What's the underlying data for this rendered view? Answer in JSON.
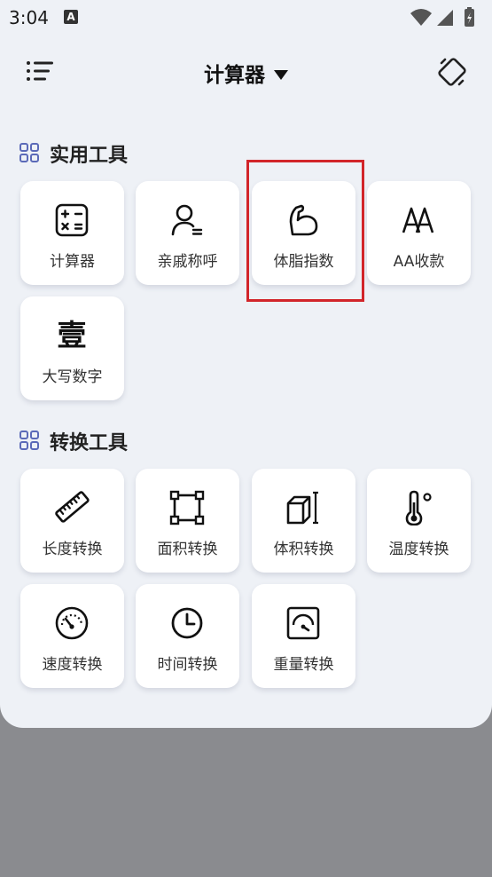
{
  "status": {
    "time": "3:04",
    "notification_icon": "A"
  },
  "header": {
    "title": "计算器"
  },
  "sections": [
    {
      "title": "实用工具",
      "tools": [
        {
          "label": "计算器",
          "icon": "calculator-icon"
        },
        {
          "label": "亲戚称呼",
          "icon": "person-icon"
        },
        {
          "label": "体脂指数",
          "icon": "muscle-arm-icon",
          "highlighted": true
        },
        {
          "label": "AA收款",
          "icon": "aa-text-icon",
          "glyph": "AA"
        },
        {
          "label": "大写数字",
          "icon": "chinese-numeral-icon",
          "glyph": "壹"
        }
      ]
    },
    {
      "title": "转换工具",
      "tools": [
        {
          "label": "长度转换",
          "icon": "ruler-icon"
        },
        {
          "label": "面积转换",
          "icon": "area-square-icon"
        },
        {
          "label": "体积转换",
          "icon": "cube-icon"
        },
        {
          "label": "温度转换",
          "icon": "thermometer-icon"
        },
        {
          "label": "速度转换",
          "icon": "speedometer-icon"
        },
        {
          "label": "时间转换",
          "icon": "clock-icon"
        },
        {
          "label": "重量转换",
          "icon": "scale-gauge-icon"
        }
      ]
    }
  ],
  "colors": {
    "highlight": "#d2252a",
    "accent": "#5b6ab8",
    "background": "#eef1f6"
  }
}
